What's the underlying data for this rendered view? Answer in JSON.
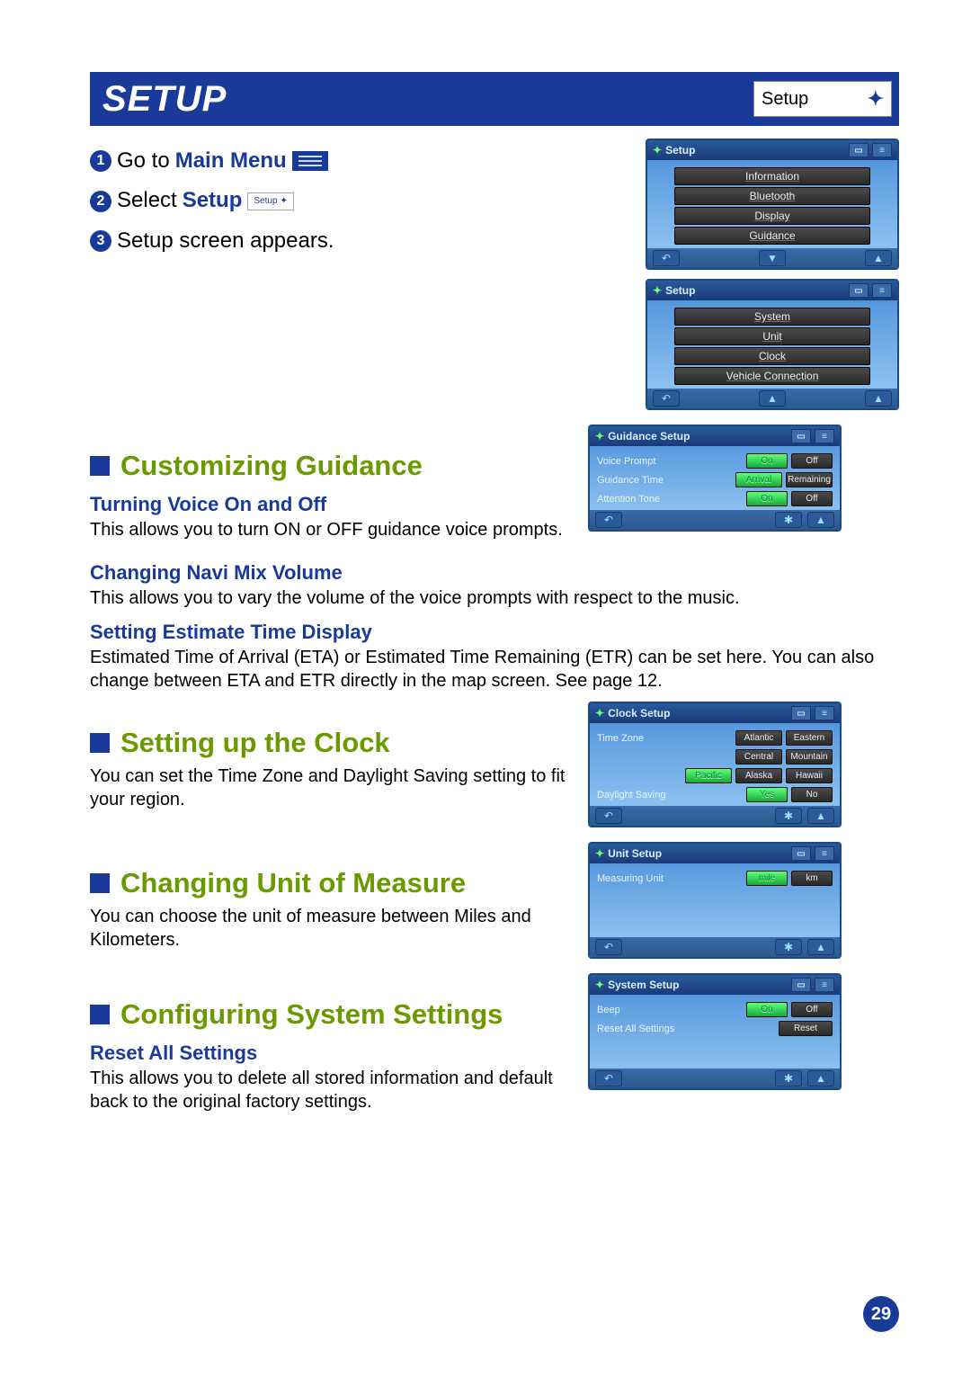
{
  "title": "SETUP",
  "setup_button": "Setup",
  "steps": {
    "s1_pre": "Go to ",
    "s1_link": "Main Menu",
    "s2_pre": "Select ",
    "s2_link": "Setup",
    "s2_btn": "Setup",
    "s3": "Setup screen appears."
  },
  "panels": {
    "setup1": {
      "title": "Setup",
      "items": [
        "Information",
        "Bluetooth",
        "Display",
        "Guidance"
      ]
    },
    "setup2": {
      "title": "Setup",
      "items": [
        "System",
        "Unit",
        "Clock",
        "Vehicle Connection"
      ]
    },
    "guidance": {
      "title": "Guidance Setup",
      "rows": [
        {
          "label": "Voice Prompt",
          "a": "On",
          "b": "Off",
          "sel": "a"
        },
        {
          "label": "Guidance Time",
          "a": "Arrival",
          "b": "Remaining",
          "sel": "a"
        },
        {
          "label": "Attention Tone",
          "a": "On",
          "b": "Off",
          "sel": "a"
        }
      ]
    },
    "clock": {
      "title": "Clock Setup",
      "tz_label": "Time Zone",
      "tz": [
        [
          "Atlantic",
          "Eastern"
        ],
        [
          "Central",
          "Mountain"
        ],
        [
          "Pacific",
          "Alaska",
          "Hawaii"
        ]
      ],
      "tz_sel": "Pacific",
      "dst_label": "Daylight Saving",
      "dst": [
        "Yes",
        "No"
      ],
      "dst_sel": "Yes"
    },
    "unit": {
      "title": "Unit Setup",
      "label": "Measuring Unit",
      "opts": [
        "mile",
        "km"
      ],
      "sel": "mile"
    },
    "system": {
      "title": "System Setup",
      "beep_label": "Beep",
      "beep": [
        "On",
        "Off"
      ],
      "beep_sel": "On",
      "reset_label": "Reset All Settings",
      "reset_btn": "Reset"
    }
  },
  "sections": {
    "guidance_h2": "Customizing Guidance",
    "voice_h3": "Turning Voice On and Off",
    "voice_body": "This allows you to turn ON or OFF guidance voice prompts.",
    "mix_h3": "Changing Navi Mix Volume",
    "mix_body": "This allows you to vary the volume of the voice prompts with respect to the music.",
    "eta_h3": "Setting Estimate Time Display",
    "eta_body": "Estimated Time of Arrival (ETA) or Estimated Time Remaining (ETR) can be set here. You can also change between ETA and ETR directly in the map screen. See page 12.",
    "clock_h2": "Setting up the Clock",
    "clock_body": "You can set the Time Zone and Daylight Saving setting to fit your region.",
    "unit_h2": "Changing Unit of Measure",
    "unit_body": "You can choose the unit of measure between Miles and Kilometers.",
    "system_h2": "Configuring System Settings",
    "reset_h3": "Reset All Settings",
    "reset_body": "This allows you to delete all stored information and default back to the original factory settings."
  },
  "page_number": "29"
}
